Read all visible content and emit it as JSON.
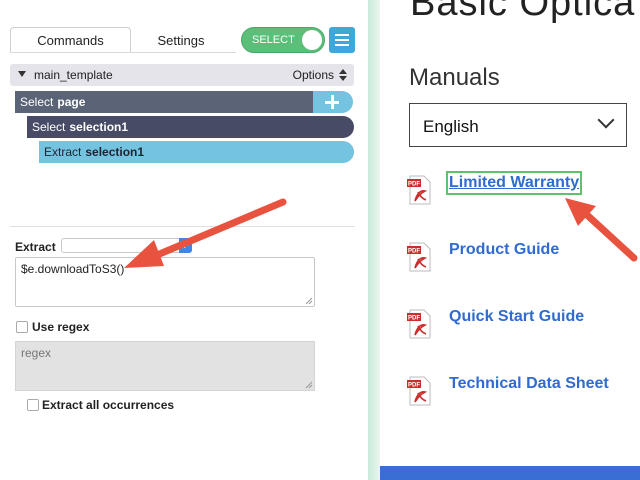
{
  "colors": {
    "toggle_green": "#5bbf7a",
    "menu_blue": "#3fa8d8",
    "page_cmd": "#5b6476",
    "select_cmd": "#474b66",
    "extract_cmd": "#74c3e0",
    "arrow_red": "#e8533f",
    "link_blue": "#2f6bd0",
    "highlight_green": "#5ec16b"
  },
  "left_panel": {
    "tabs": [
      {
        "label": "Commands",
        "active": true
      },
      {
        "label": "Settings",
        "active": false
      }
    ],
    "toggle_label": "SELECT",
    "menu_icon": "hamburger-icon",
    "template": {
      "name": "main_template",
      "options_label": "Options"
    },
    "commands": [
      {
        "verb": "Select",
        "target": "page"
      },
      {
        "verb": "Select",
        "target": "selection1"
      },
      {
        "verb": "Extract",
        "target": "selection1"
      }
    ],
    "extract": {
      "label": "Extract",
      "selected_option": "",
      "code": "$e.downloadToS3()"
    },
    "regex": {
      "label": "Use regex",
      "checked": false,
      "placeholder": "regex"
    },
    "extract_all": {
      "label": "Extract all occurrences",
      "checked": false
    }
  },
  "right_panel": {
    "title": "Basic Optica",
    "manuals_heading": "Manuals",
    "language": "English",
    "manuals": [
      {
        "label": "Limited Warranty",
        "highlighted": true
      },
      {
        "label": "Product Guide",
        "highlighted": false
      },
      {
        "label": "Quick Start Guide",
        "highlighted": false
      },
      {
        "label": "Technical Data Sheet",
        "highlighted": false
      }
    ],
    "pdf_icon_text": "PDF"
  }
}
